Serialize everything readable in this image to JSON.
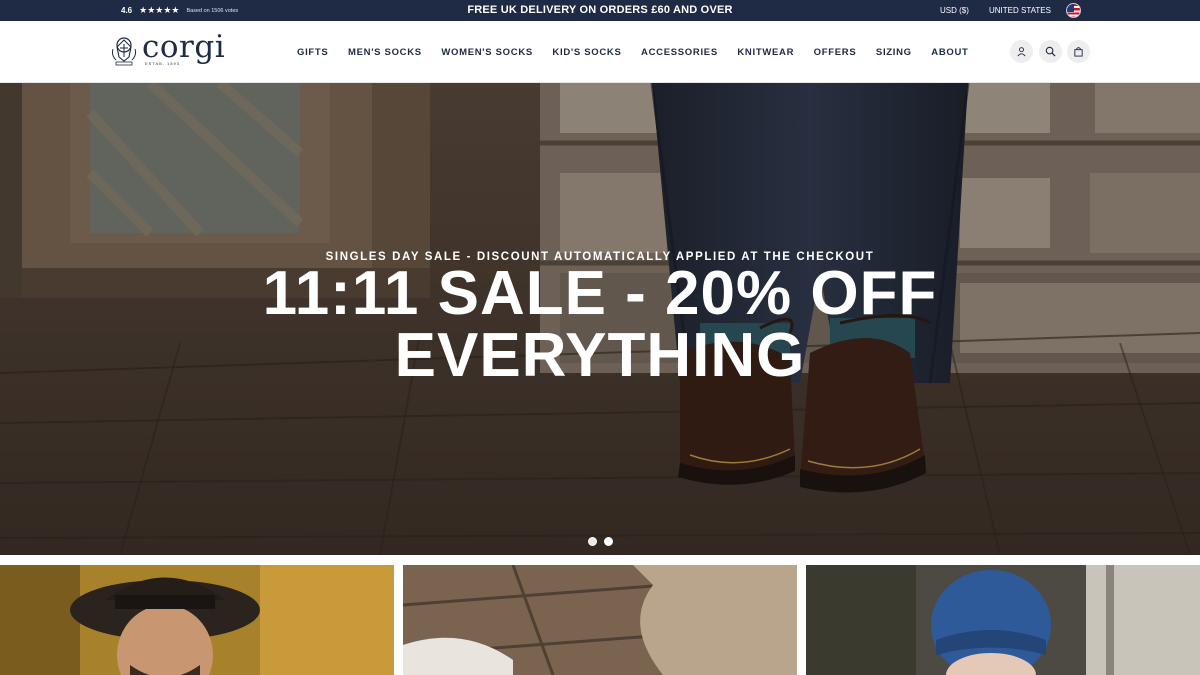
{
  "topbar": {
    "rating_score": "4.6",
    "stars": "★★★★★",
    "rating_votes": "Based on 1506 votes",
    "promo": "FREE UK DELIVERY ON ORDERS £60 AND OVER",
    "currency": "USD ($)",
    "country": "UNITED STATES",
    "flag_icon": "us-flag-icon"
  },
  "header": {
    "logo_text": "corgi",
    "logo_sub": "ESTAB. 1893",
    "nav": [
      "GIFTS",
      "MEN'S SOCKS",
      "WOMEN'S SOCKS",
      "KID'S SOCKS",
      "ACCESSORIES",
      "KNITWEAR",
      "OFFERS",
      "SIZING",
      "ABOUT"
    ],
    "icons": [
      "account-icon",
      "search-icon",
      "bag-icon"
    ]
  },
  "hero": {
    "eyebrow": "SINGLES DAY SALE - DISCOUNT AUTOMATICALLY APPLIED AT THE CHECKOUT",
    "title_line1": "11:11 SALE - 20% OFF",
    "title_line2": "EVERYTHING",
    "slides": 2,
    "active_slide": 1
  },
  "colors": {
    "navy": "#1f2a44",
    "white": "#ffffff"
  }
}
